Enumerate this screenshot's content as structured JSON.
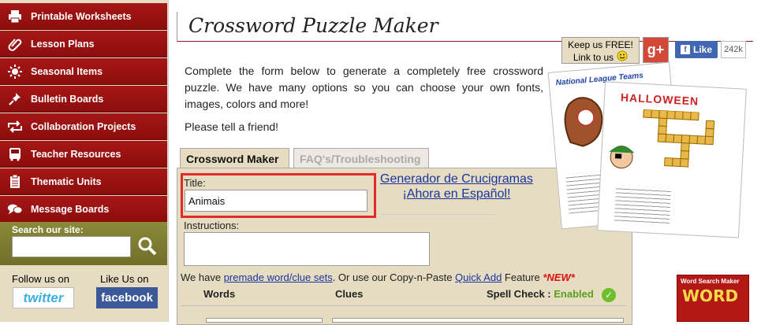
{
  "sidebar": {
    "items": [
      {
        "label": "Printable Worksheets",
        "icon": "printer-icon"
      },
      {
        "label": "Lesson Plans",
        "icon": "paperclip-icon"
      },
      {
        "label": "Seasonal Items",
        "icon": "sun-icon"
      },
      {
        "label": "Bulletin Boards",
        "icon": "pushpin-icon"
      },
      {
        "label": "Collaboration Projects",
        "icon": "swap-arrows-icon"
      },
      {
        "label": "Teacher Resources",
        "icon": "bus-icon"
      },
      {
        "label": "Thematic Units",
        "icon": "clipboard-icon"
      },
      {
        "label": "Message Boards",
        "icon": "chat-bubbles-icon"
      }
    ],
    "search_label": "Search our site:",
    "search_placeholder": "",
    "follow_label": "Follow us on",
    "like_label": "Like Us on",
    "twitter_label": "twitter",
    "facebook_label": "facebook"
  },
  "header": {
    "title": "Crossword Puzzle Maker",
    "keep_free_line1": "Keep us FREE!",
    "keep_free_line2": "Link to us",
    "gplus_label": "g+",
    "fb_like_label": "Like",
    "fb_like_count": "242k"
  },
  "main": {
    "intro": "Complete the form below to generate a completely free crossword puzzle. We have many options so you can choose your own fonts, images, colors and more!",
    "tell_friend": "Please tell a friend!",
    "tabs": [
      {
        "label": "Crossword Maker",
        "active": true
      },
      {
        "label": "FAQ's/Troubleshooting",
        "active": false
      }
    ],
    "form": {
      "title_label": "Title:",
      "title_value": "Animais",
      "spanish_link_line1": "Generador de Crucigramas",
      "spanish_link_line2": "¡Ahora en Español!",
      "instructions_label": "Instructions:",
      "instructions_value": "",
      "premade_prefix": "We have ",
      "premade_link": "premade word/clue sets",
      "premade_middle": ". Or use our Copy-n-Paste ",
      "quick_add_link": "Quick Add",
      "feature_text": " Feature ",
      "new_badge": "*NEW*",
      "words_header": "Words",
      "clues_header": "Clues",
      "spell_check_label": "Spell Check :",
      "spell_check_status": "Enabled"
    }
  },
  "promo": {
    "puzzle1_title": "National League Teams",
    "puzzle2_title": "HALLOWEEN",
    "word_search_label": "Word Search Maker",
    "word_search_word": "WORD"
  },
  "colors": {
    "nav_red": "#a61716",
    "panel_tan": "#e6dcc1",
    "link_blue": "#1a35a0",
    "highlight_red": "#e12b27",
    "enabled_green": "#5aa11b"
  }
}
